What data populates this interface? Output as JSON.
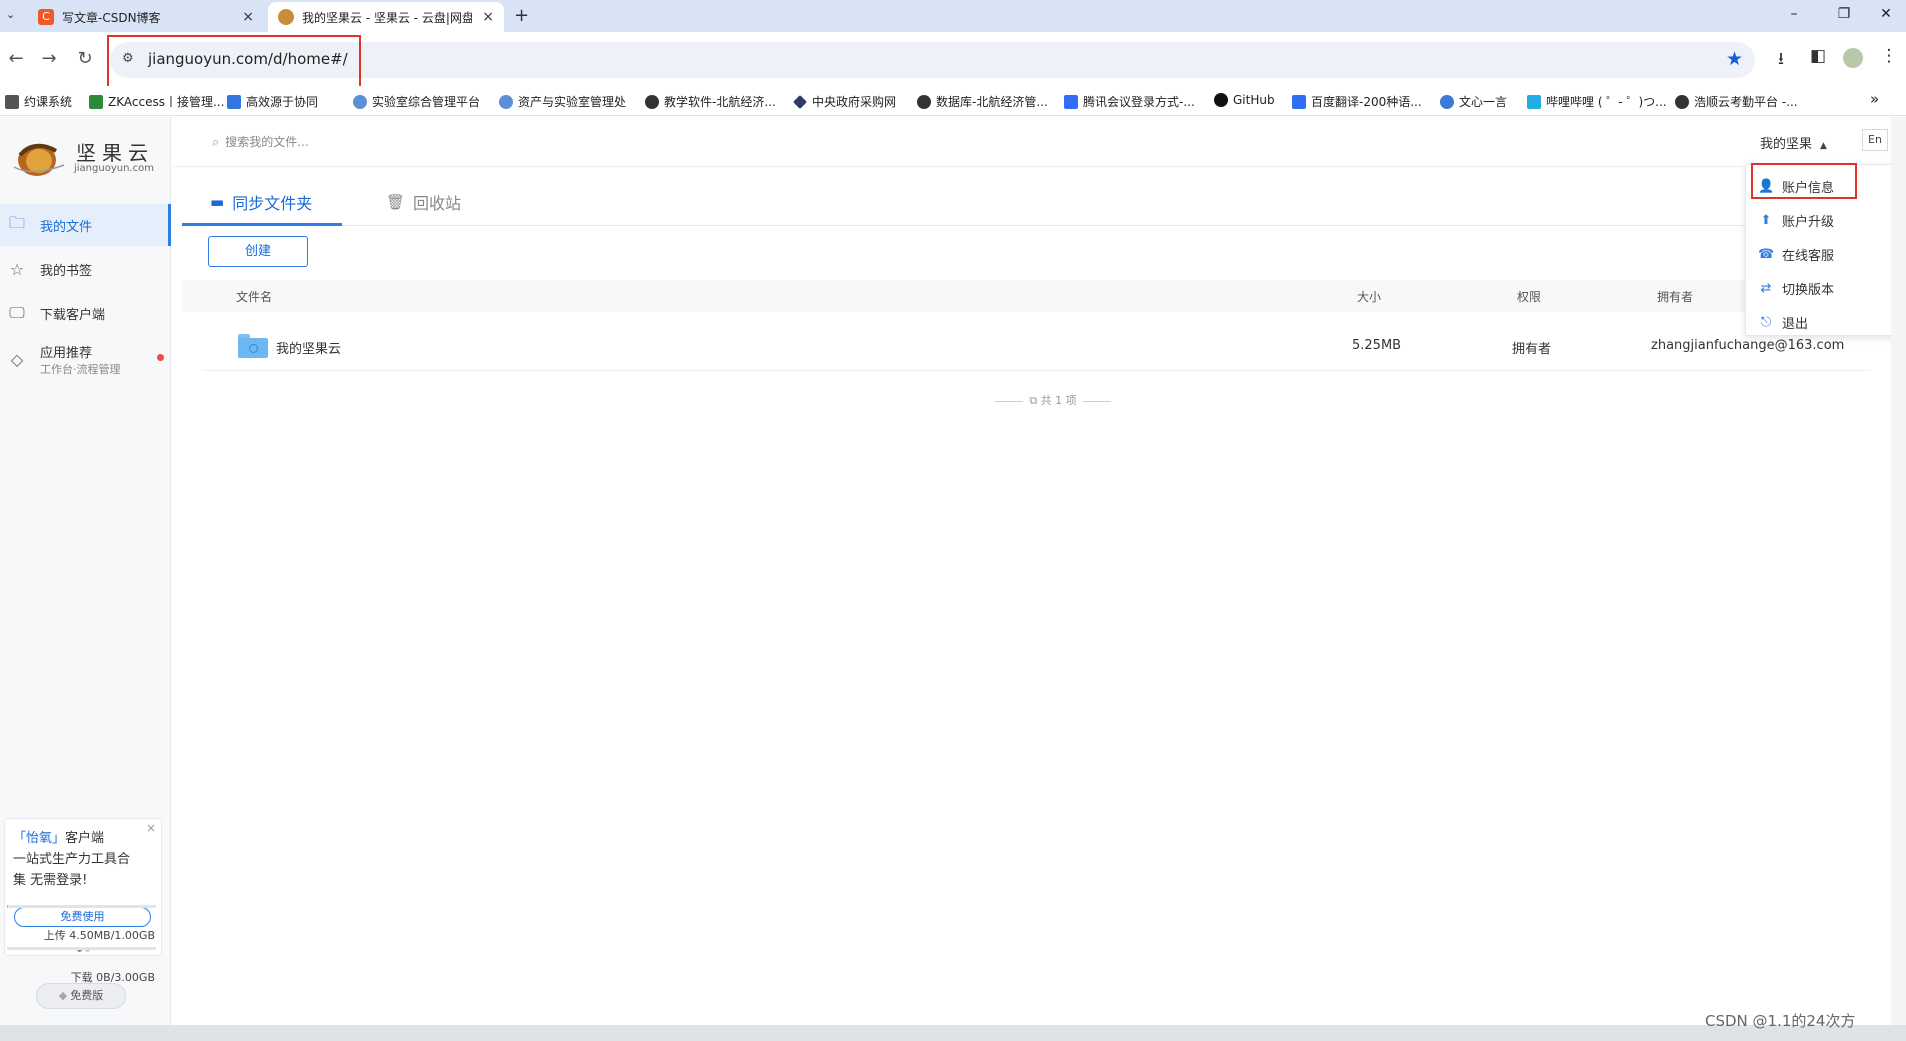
{
  "browser": {
    "tabs": [
      {
        "title": "写文章-CSDN博客",
        "color": "#f05a28",
        "active": false
      },
      {
        "title": "我的坚果云 - 坚果云 - 云盘|网盘",
        "color": "#c98d3e",
        "active": true
      }
    ],
    "url": "jianguoyun.com/d/home#/",
    "bookmarks": [
      {
        "label": "约课系统",
        "color": "#555555"
      },
      {
        "label": "ZKAccess丨接管理...",
        "color": "#2c8a3d"
      },
      {
        "label": "高效源于协同",
        "color": "#3476e0"
      },
      {
        "label": "实验室综合管理平台",
        "color": "#5b8fd6"
      },
      {
        "label": "资产与实验室管理处",
        "color": "#5b8fd6"
      },
      {
        "label": "教学软件-北航经济...",
        "color": "#333333"
      },
      {
        "label": "中央政府采购网",
        "color": "#2b3a67"
      },
      {
        "label": "数据库-北航经济管...",
        "color": "#333333"
      },
      {
        "label": "腾讯会议登录方式-...",
        "color": "#2f6ef5"
      },
      {
        "label": "GitHub",
        "color": "#111111"
      },
      {
        "label": "百度翻译-200种语...",
        "color": "#2f6ef5"
      },
      {
        "label": "文心一言",
        "color": "#3a7bd5"
      },
      {
        "label": "哔哩哔哩 ( ゜- ゜)つ...",
        "color": "#23ade5"
      },
      {
        "label": "浩顺云考勤平台 -...",
        "color": "#333333"
      }
    ],
    "more_bookmarks": "»"
  },
  "app": {
    "logo": {
      "name": "坚果云",
      "domain": "jianguoyun.com"
    },
    "search_placeholder": "搜索我的文件...",
    "user_menu_label": "我的坚果",
    "lang_button": "En",
    "sidebar": {
      "items": [
        {
          "label": "我的文件",
          "icon": "folder-icon",
          "active": true
        },
        {
          "label": "我的书签",
          "icon": "star-icon",
          "active": false
        },
        {
          "label": "下载客户端",
          "icon": "monitor-icon",
          "active": false
        },
        {
          "label": "应用推荐",
          "sub": "工作台·流程管理",
          "icon": "tag-icon",
          "active": false
        }
      ],
      "promo": {
        "line1_highlight": "「怡氧」",
        "line1_rest": "客户端",
        "line2": "一站式生产力工具合",
        "line3": "集 无需登录!",
        "button": "免费使用",
        "close": "×"
      },
      "plan": "免费版",
      "upload_quota": "上传 4.50MB/1.00GB",
      "upload_fraction": 0.0044,
      "download_quota": "下载 0B/3.00GB",
      "download_fraction": 0.0
    },
    "tabs": [
      {
        "label": "同步文件夹",
        "active": true
      },
      {
        "label": "回收站",
        "active": false
      }
    ],
    "create_button": "创建",
    "table": {
      "columns": [
        "文件名",
        "大小",
        "权限",
        "拥有者"
      ],
      "rows": [
        {
          "name": "我的坚果云",
          "size": "5.25MB",
          "permission": "拥有者",
          "owner": "zhangjianfuchange@163.com"
        }
      ],
      "count_text": "共 1 项"
    },
    "dropdown": [
      {
        "label": "账户信息",
        "icon": "user-icon"
      },
      {
        "label": "账户升级",
        "icon": "user-upgrade-icon"
      },
      {
        "label": "在线客服",
        "icon": "headset-icon"
      },
      {
        "label": "切换版本",
        "icon": "switch-icon"
      },
      {
        "label": "退出",
        "icon": "logout-icon"
      }
    ]
  },
  "watermark": "CSDN @1.1的24次方"
}
